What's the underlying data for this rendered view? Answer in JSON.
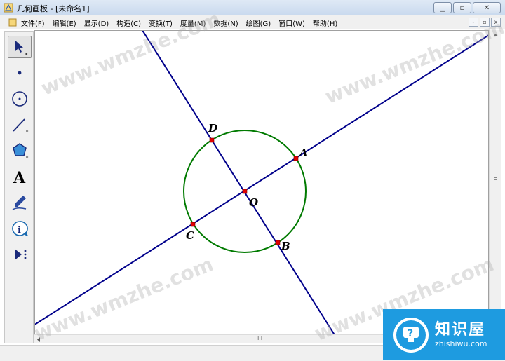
{
  "window": {
    "title": "几何画板 - [未命名1]"
  },
  "menu": [
    "文件(F)",
    "编辑(E)",
    "显示(D)",
    "构造(C)",
    "变换(T)",
    "度量(M)",
    "数据(N)",
    "绘图(G)",
    "窗口(W)",
    "帮助(H)"
  ],
  "tools": [
    "arrow-select-tool",
    "point-tool",
    "compass-tool",
    "straightedge-tool",
    "polygon-tool",
    "text-tool",
    "marker-tool",
    "information-tool",
    "custom-tool"
  ],
  "geometry": {
    "points": [
      {
        "label": "A"
      },
      {
        "label": "B"
      },
      {
        "label": "C"
      },
      {
        "label": "D"
      },
      {
        "label": "O"
      }
    ],
    "colors": {
      "line": "#00008b",
      "circle": "#007a00",
      "point": "#e00000"
    }
  },
  "watermark": {
    "text": "www.wmzhe.com"
  },
  "brand": {
    "name": "知识屋",
    "domain": "zhishiwu.com",
    "color": "#1e9be0"
  },
  "scrollbar": {
    "grip": "III"
  }
}
